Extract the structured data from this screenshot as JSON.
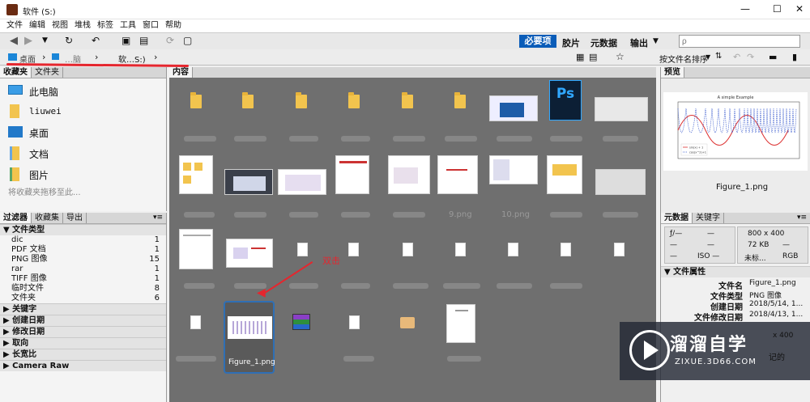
{
  "window": {
    "title": "软件 (S:)",
    "min": "—",
    "max": "☐",
    "close": "✕"
  },
  "menu": [
    "文件",
    "编辑",
    "视图",
    "堆栈",
    "标签",
    "工具",
    "窗口",
    "帮助"
  ],
  "toolbar": {
    "workspace_tabs": [
      "必要项",
      "胶片",
      "元数据",
      "输出"
    ],
    "search_placeholder": "ρ",
    "sort_label": "按文件名排序"
  },
  "path": {
    "items": [
      "桌面",
      "…脑",
      "软…S:)"
    ]
  },
  "favorites": {
    "tabs": [
      "收藏夹",
      "文件夹"
    ],
    "items": [
      "此电脑",
      "liuwei",
      "桌面",
      "文档",
      "图片"
    ],
    "hint": "将收藏夹拖移至此..."
  },
  "filter": {
    "tabs": [
      "过滤器",
      "收藏集",
      "导出"
    ],
    "groups": [
      "文件类型",
      "关键字",
      "创建日期",
      "修改日期",
      "取向",
      "长宽比",
      "Camera Raw"
    ],
    "filetypes": [
      {
        "name": "dic",
        "count": "1"
      },
      {
        "name": "PDF 文档",
        "count": "1"
      },
      {
        "name": "PNG 图像",
        "count": "15"
      },
      {
        "name": "rar",
        "count": "1"
      },
      {
        "name": "TIFF 图像",
        "count": "1"
      },
      {
        "name": "临时文件",
        "count": "8"
      },
      {
        "name": "文件夹",
        "count": "6"
      }
    ]
  },
  "content": {
    "tab": "内容",
    "labels": [
      "9.png",
      "10.png"
    ],
    "selected_label": "Figure_1.png",
    "annotation": "双击",
    "app_icon": "Ps"
  },
  "preview": {
    "tab": "预览",
    "caption": "Figure_1.png",
    "chart_title": "A simple Example",
    "legend": [
      "sin(x) + 1",
      "cos(x^2)+1"
    ]
  },
  "metadata": {
    "tabs": [
      "元数据",
      "关键字"
    ],
    "camera": {
      "f": "ƒ/—",
      "dash": "—",
      "iso": "ISO —"
    },
    "size": "800 x 400",
    "filesize": "72 KB",
    "unmarked": "未标...",
    "mode": "RGB",
    "section": "文件属性",
    "props": [
      {
        "key": "文件名",
        "value": "Figure_1.png"
      },
      {
        "key": "文件类型",
        "value": "PNG 图像"
      },
      {
        "key": "创建日期",
        "value": "2018/5/14, 1..."
      },
      {
        "key": "文件修改日期",
        "value": "2018/4/13, 1..."
      }
    ],
    "more_value": "x 400",
    "more_value2": "记的"
  },
  "watermark": {
    "brand": "溜溜自学",
    "url": "ZIXUE.3D66.COM"
  },
  "colors": {
    "accent": "#0a5cb8",
    "red_annotation": "#e5262e",
    "content_bg": "#6f6f6f"
  }
}
